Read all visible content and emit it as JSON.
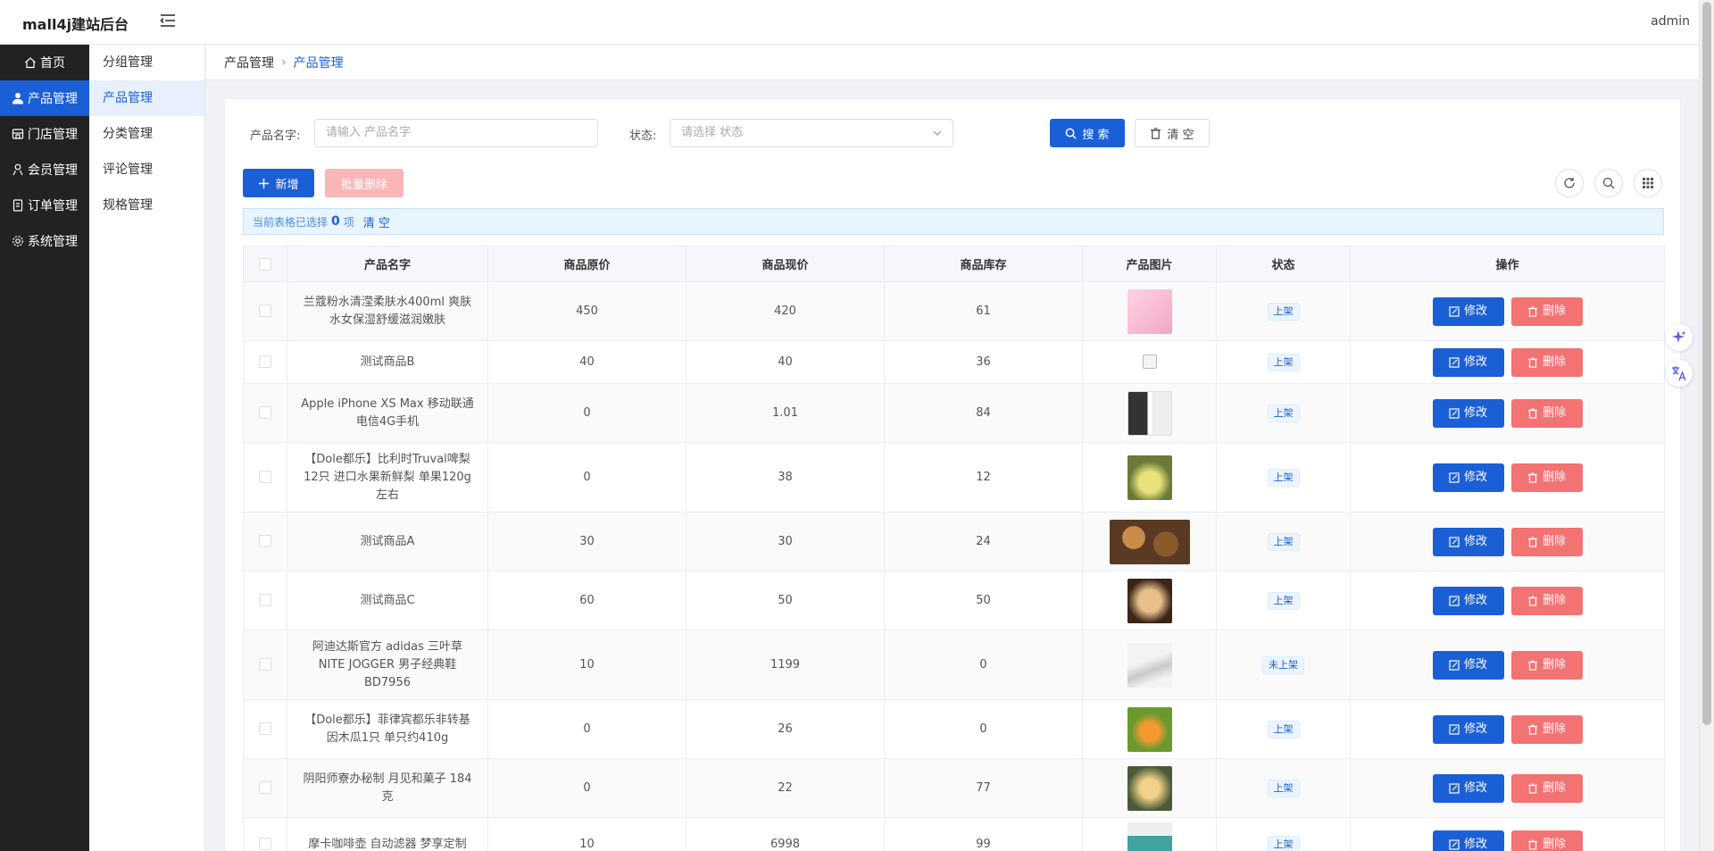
{
  "app": {
    "title": "mall4j建站后台",
    "user": "admin"
  },
  "sidebar": [
    {
      "label": "首页",
      "icon": "home-icon"
    },
    {
      "label": "产品管理",
      "icon": "user-icon",
      "active": true
    },
    {
      "label": "门店管理",
      "icon": "store-icon"
    },
    {
      "label": "会员管理",
      "icon": "member-icon"
    },
    {
      "label": "订单管理",
      "icon": "order-icon"
    },
    {
      "label": "系统管理",
      "icon": "gear-icon"
    }
  ],
  "subnav": [
    {
      "label": "分组管理"
    },
    {
      "label": "产品管理",
      "active": true
    },
    {
      "label": "分类管理"
    },
    {
      "label": "评论管理"
    },
    {
      "label": "规格管理"
    }
  ],
  "breadcrumb": {
    "parent": "产品管理",
    "current": "产品管理"
  },
  "search": {
    "name_label": "产品名字:",
    "name_placeholder": "请输入 产品名字",
    "status_label": "状态:",
    "status_placeholder": "请选择 状态",
    "search_btn": "搜 索",
    "clear_btn": "清 空"
  },
  "toolbar": {
    "add_btn": "新增",
    "batch_delete_btn": "批量删除"
  },
  "selection": {
    "prefix": "当前表格已选择",
    "count": "0",
    "suffix": "项",
    "clear": "清 空"
  },
  "table": {
    "headers": [
      "产品名字",
      "商品原价",
      "商品现价",
      "商品库存",
      "产品图片",
      "状态",
      "操作"
    ],
    "edit_label": "修改",
    "delete_label": "删除",
    "rows": [
      {
        "name": "兰蔻粉水清滢柔肤水400ml 爽肤水女保湿舒缓滋润嫩肤",
        "original": "450",
        "price": "420",
        "stock": "61",
        "status": "上架",
        "img": "pink-bottle"
      },
      {
        "name": "测试商品B",
        "original": "40",
        "price": "40",
        "stock": "36",
        "status": "上架",
        "img": "broken"
      },
      {
        "name": "Apple iPhone XS Max 移动联通电信4G手机",
        "original": "0",
        "price": "1.01",
        "stock": "84",
        "status": "上架",
        "img": "phone"
      },
      {
        "name": "【Dole都乐】比利时Truval啤梨 12只 进口水果新鲜梨 单果120g左右",
        "original": "0",
        "price": "38",
        "stock": "12",
        "status": "上架",
        "img": "pear"
      },
      {
        "name": "测试商品A",
        "original": "30",
        "price": "30",
        "stock": "24",
        "status": "上架",
        "img": "donuts"
      },
      {
        "name": "测试商品C",
        "original": "60",
        "price": "50",
        "stock": "50",
        "status": "上架",
        "img": "pastry"
      },
      {
        "name": "阿迪达斯官方 adidas 三叶草 NITE JOGGER 男子经典鞋 BD7956",
        "original": "10",
        "price": "1199",
        "stock": "0",
        "status": "未上架",
        "img": "shoe"
      },
      {
        "name": "【Dole都乐】菲律宾都乐非转基因木瓜1只 单只约410g",
        "original": "0",
        "price": "26",
        "stock": "0",
        "status": "上架",
        "img": "papaya"
      },
      {
        "name": "阴阳师寮办秘制 月见和菓子 184克",
        "original": "0",
        "price": "22",
        "stock": "77",
        "status": "上架",
        "img": "mooncake"
      },
      {
        "name": "摩卡咖啡壶 自动滤器 梦享定制",
        "original": "10",
        "price": "6998",
        "stock": "99",
        "status": "上架",
        "img": "teal"
      }
    ]
  }
}
